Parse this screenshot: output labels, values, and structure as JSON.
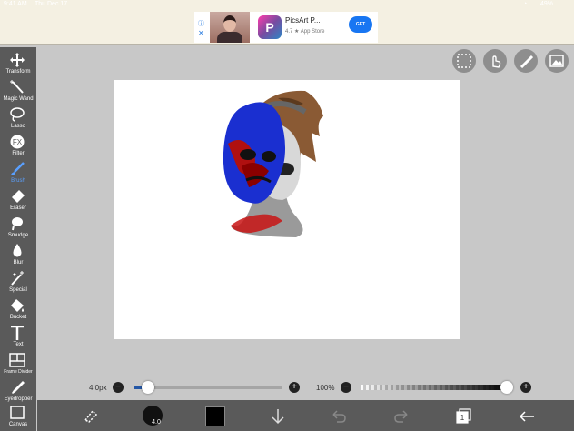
{
  "status_bar": {
    "time": "9:41 AM",
    "date": "Thu Dec 17",
    "battery": "49%"
  },
  "ad": {
    "info": "ⓘ",
    "close": "✕",
    "app_name": "PicsArt P...",
    "rating": "4.7",
    "store": "App Store",
    "cta": "GET",
    "logo_letter": "P"
  },
  "tools": [
    {
      "label": "Transform",
      "icon": "move-arrows"
    },
    {
      "label": "Magic Wand",
      "icon": "magic-wand"
    },
    {
      "label": "Lasso",
      "icon": "lasso"
    },
    {
      "label": "Filter",
      "icon": "fx"
    },
    {
      "label": "Brush",
      "icon": "brush"
    },
    {
      "label": "Eraser",
      "icon": "eraser"
    },
    {
      "label": "Smudge",
      "icon": "smudge"
    },
    {
      "label": "Blur",
      "icon": "droplet"
    },
    {
      "label": "Special",
      "icon": "sparkle-wand"
    },
    {
      "label": "Bucket",
      "icon": "bucket"
    },
    {
      "label": "Text",
      "icon": "text-t"
    },
    {
      "label": "Frame Divider",
      "icon": "frame-divider"
    },
    {
      "label": "Eyedropper",
      "icon": "eyedropper"
    },
    {
      "label": "Canvas",
      "icon": "canvas"
    }
  ],
  "selected_tool": "Brush",
  "fx_label": "FX",
  "brush_size": {
    "label": "4.0px",
    "value_fraction": 0.08
  },
  "opacity": {
    "label": "100%",
    "value_fraction": 1.0
  },
  "bottom_bar": {
    "brush_size_badge": "4.0",
    "layer_count": "1",
    "primary_color": "#000000"
  },
  "colors": {
    "accent": "#2a7de1",
    "toolbar": "#5a5a5a"
  }
}
